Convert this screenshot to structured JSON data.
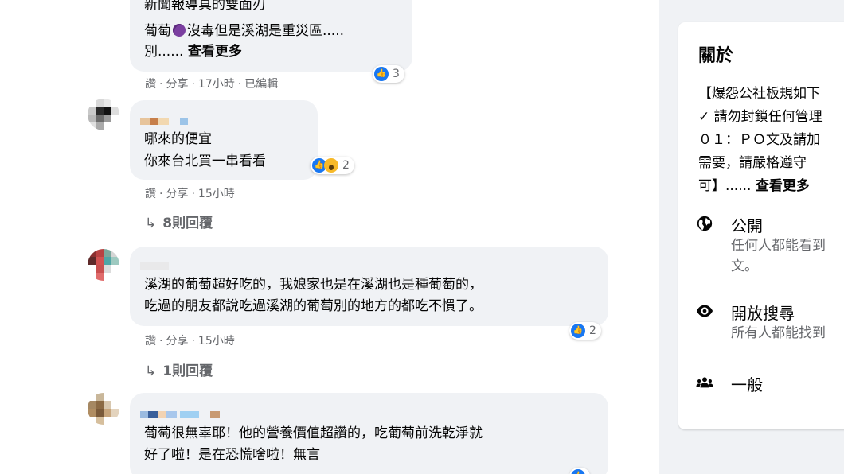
{
  "comments": [
    {
      "text_lines": [
        "新聞報導真的雙面刃",
        "葡萄",
        "沒毒但是溪湖是重災區.....",
        "別......"
      ],
      "see_more": "查看更多",
      "meta": {
        "action": "讚",
        "share": "分享",
        "time": "17小時",
        "edited": "已編輯"
      },
      "reaction_count": "3"
    },
    {
      "text_lines": [
        "哪來的便宜",
        "你來台北買一串看看"
      ],
      "meta": {
        "action": "讚",
        "share": "分享",
        "time": "15小時"
      },
      "reaction_count": "2",
      "replies": "8則回覆"
    },
    {
      "text_lines": [
        "溪湖的葡萄超好吃的，我娘家也是在溪湖也是種葡萄的，",
        "吃過的朋友都說吃過溪湖的葡萄別的地方的都吃不慣了。"
      ],
      "meta": {
        "action": "讚",
        "share": "分享",
        "time": "15小時"
      },
      "reaction_count": "2",
      "replies": "1則回覆"
    },
    {
      "text_lines": [
        "葡萄很無辜耶！他的營養價值超讚的，吃葡萄前洗乾淨就",
        "好了啦！是在恐慌啥啦！無言"
      ]
    }
  ],
  "about": {
    "title": "關於",
    "rules_lines": [
      "【爆怨公社板規如下",
      "✓ 請勿封鎖任何管理",
      "０１：ＰＯ文及請加",
      "需要，請嚴格遵守",
      "可】......"
    ],
    "rules_see_more": "查看更多",
    "items": [
      {
        "icon": "globe-icon",
        "title": "公開",
        "desc_lines": [
          "任何人都能看到",
          "文。"
        ]
      },
      {
        "icon": "eye-icon",
        "title": "開放搜尋",
        "desc_lines": [
          "所有人都能找到"
        ]
      },
      {
        "icon": "group-icon",
        "title": "一般"
      }
    ]
  },
  "colors": {
    "like_blue": "#1877f2",
    "bubble": "#f0f2f5",
    "secondary_text": "#65676b",
    "wow_yellow": "#f7b928"
  }
}
